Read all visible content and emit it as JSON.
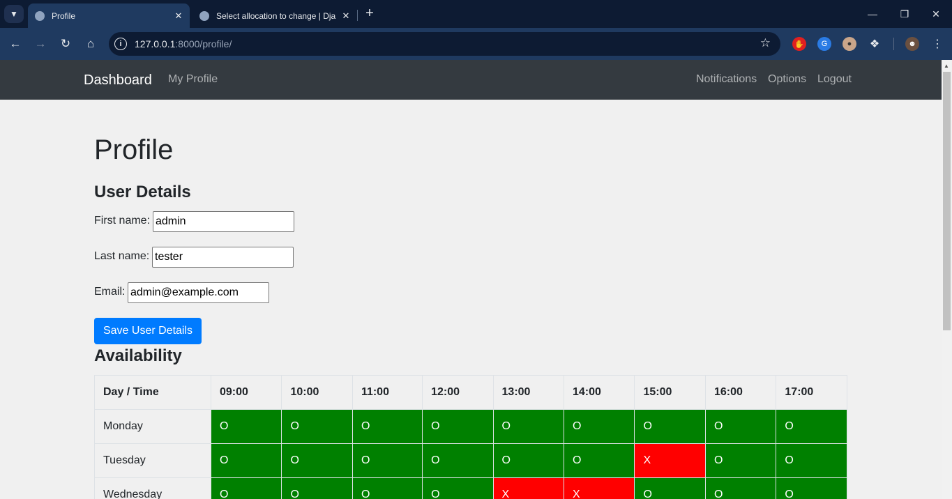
{
  "browser": {
    "tabs": [
      {
        "title": "Profile",
        "active": true
      },
      {
        "title": "Select allocation to change | Dja",
        "active": false
      }
    ],
    "url_host": "127.0.0.1",
    "url_path": ":8000/profile/"
  },
  "navbar": {
    "brand": "Dashboard",
    "left_links": [
      "My Profile"
    ],
    "right_links": [
      "Notifications",
      "Options",
      "Logout"
    ]
  },
  "page": {
    "title": "Profile",
    "user_details_heading": "User Details",
    "first_name_label": "First name:",
    "first_name_value": "admin",
    "last_name_label": "Last name:",
    "last_name_value": "tester",
    "email_label": "Email:",
    "email_value": "admin@example.com",
    "save_button": "Save User Details",
    "availability_heading": "Availability"
  },
  "availability": {
    "header_day": "Day / Time",
    "times": [
      "09:00",
      "10:00",
      "11:00",
      "12:00",
      "13:00",
      "14:00",
      "15:00",
      "16:00",
      "17:00"
    ],
    "rows": [
      {
        "day": "Monday",
        "slots": [
          "O",
          "O",
          "O",
          "O",
          "O",
          "O",
          "O",
          "O",
          "O"
        ]
      },
      {
        "day": "Tuesday",
        "slots": [
          "O",
          "O",
          "O",
          "O",
          "O",
          "O",
          "X",
          "O",
          "O"
        ]
      },
      {
        "day": "Wednesday",
        "slots": [
          "O",
          "O",
          "O",
          "O",
          "X",
          "X",
          "O",
          "O",
          "O"
        ]
      }
    ],
    "colors": {
      "available": "#008000",
      "unavailable": "#ff0000"
    }
  }
}
